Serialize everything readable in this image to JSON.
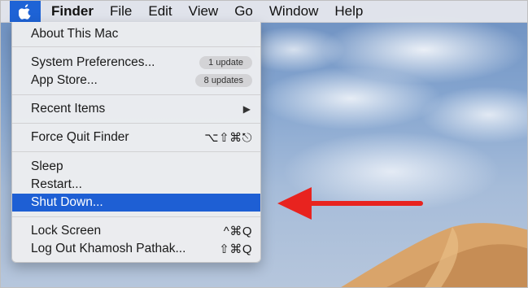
{
  "menubar": {
    "apple_icon": "apple-icon",
    "items": [
      "Finder",
      "File",
      "Edit",
      "View",
      "Go",
      "Window",
      "Help"
    ]
  },
  "apple_menu": {
    "about": "About This Mac",
    "system_preferences": "System Preferences...",
    "system_preferences_badge": "1 update",
    "app_store": "App Store...",
    "app_store_badge": "8 updates",
    "recent_items": "Recent Items",
    "force_quit": "Force Quit Finder",
    "force_quit_shortcut": "⌥⇧⌘⎋",
    "sleep": "Sleep",
    "restart": "Restart...",
    "shut_down": "Shut Down...",
    "lock_screen": "Lock Screen",
    "lock_screen_shortcut": "^⌘Q",
    "log_out": "Log Out Khamosh Pathak...",
    "log_out_shortcut": "⇧⌘Q"
  },
  "colors": {
    "selection": "#1e5fd4",
    "annotation_arrow": "#e8231f"
  }
}
